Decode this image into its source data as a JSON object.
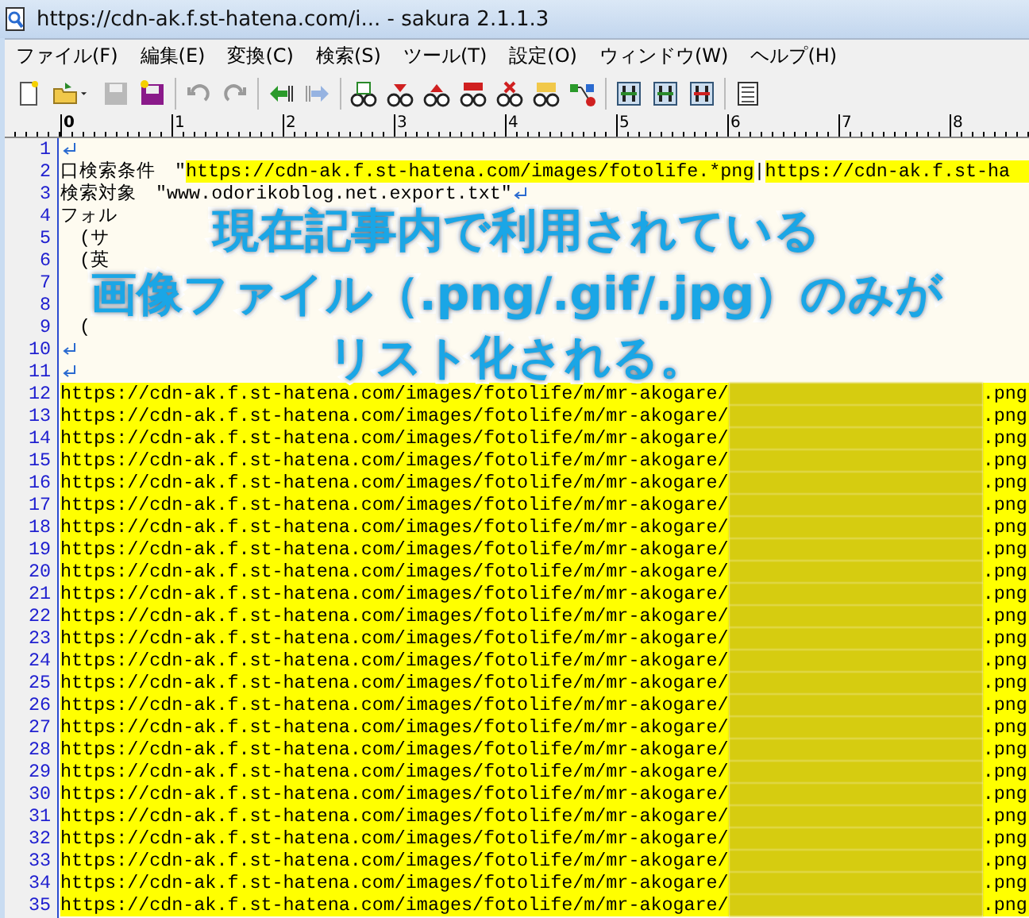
{
  "window": {
    "title": "https://cdn-ak.f.st-hatena.com/i... - sakura 2.1.1.3"
  },
  "menu": [
    "ファイル(F)",
    "編集(E)",
    "変換(C)",
    "検索(S)",
    "ツール(T)",
    "設定(O)",
    "ウィンドウ(W)",
    "ヘルプ(H)"
  ],
  "ruler": [
    "0",
    "1",
    "2",
    "3",
    "4",
    "5",
    "6",
    "7",
    "8"
  ],
  "lines": [
    {
      "number": "1",
      "return_mark": true
    },
    {
      "number": "2",
      "return_mark": false,
      "segments": [
        {
          "kind": "plain",
          "text": "口検索条件　\""
        },
        {
          "kind": "highlight",
          "text": "https://cdn-ak.f.st-hatena.com/images/fotolife.*png"
        },
        {
          "kind": "plain",
          "text": "|"
        },
        {
          "kind": "highlight",
          "text": "https://cdn-ak.f.st-ha"
        }
      ]
    },
    {
      "number": "3",
      "return_mark": true,
      "segments": [
        {
          "kind": "plain",
          "text": "検索対象　\"www.odorikoblog.net.export.txt\""
        }
      ]
    },
    {
      "number": "4",
      "return_mark": false,
      "segments": [
        {
          "kind": "plain",
          "text": "フォル"
        }
      ]
    },
    {
      "number": "5",
      "return_mark": false,
      "segments": [
        {
          "kind": "plain",
          "text": "　(サ"
        }
      ]
    },
    {
      "number": "6",
      "return_mark": false,
      "segments": [
        {
          "kind": "plain",
          "text": "　(英"
        }
      ]
    },
    {
      "number": "7",
      "return_mark": false
    },
    {
      "number": "8",
      "return_mark": false
    },
    {
      "number": "9",
      "return_mark": false,
      "segments": [
        {
          "kind": "plain",
          "text": "　("
        }
      ]
    },
    {
      "number": "10",
      "return_mark": true
    },
    {
      "number": "11",
      "return_mark": true
    },
    {
      "number": "12",
      "return_mark": false,
      "segments": [
        {
          "kind": "highlight",
          "text": "https://cdn-ak.f.st-hatena.com/images/fotolife/m/mr-akogare/"
        },
        {
          "kind": "redacted"
        },
        {
          "kind": "highlight",
          "text": ".png"
        }
      ]
    },
    {
      "number": "13",
      "return_mark": false,
      "segments": [
        {
          "kind": "highlight",
          "text": "https://cdn-ak.f.st-hatena.com/images/fotolife/m/mr-akogare/"
        },
        {
          "kind": "redacted"
        },
        {
          "kind": "highlight",
          "text": ".png"
        }
      ]
    },
    {
      "number": "14",
      "return_mark": false,
      "segments": [
        {
          "kind": "highlight",
          "text": "https://cdn-ak.f.st-hatena.com/images/fotolife/m/mr-akogare/"
        },
        {
          "kind": "redacted"
        },
        {
          "kind": "highlight",
          "text": ".png"
        }
      ]
    },
    {
      "number": "15",
      "return_mark": false,
      "segments": [
        {
          "kind": "highlight",
          "text": "https://cdn-ak.f.st-hatena.com/images/fotolife/m/mr-akogare/"
        },
        {
          "kind": "redacted"
        },
        {
          "kind": "highlight",
          "text": ".png"
        }
      ]
    },
    {
      "number": "16",
      "return_mark": false,
      "segments": [
        {
          "kind": "highlight",
          "text": "https://cdn-ak.f.st-hatena.com/images/fotolife/m/mr-akogare/"
        },
        {
          "kind": "redacted"
        },
        {
          "kind": "highlight",
          "text": ".png"
        }
      ]
    },
    {
      "number": "17",
      "return_mark": false,
      "segments": [
        {
          "kind": "highlight",
          "text": "https://cdn-ak.f.st-hatena.com/images/fotolife/m/mr-akogare/"
        },
        {
          "kind": "redacted"
        },
        {
          "kind": "highlight",
          "text": ".png"
        }
      ]
    },
    {
      "number": "18",
      "return_mark": false,
      "segments": [
        {
          "kind": "highlight",
          "text": "https://cdn-ak.f.st-hatena.com/images/fotolife/m/mr-akogare/"
        },
        {
          "kind": "redacted"
        },
        {
          "kind": "highlight",
          "text": ".png"
        }
      ]
    },
    {
      "number": "19",
      "return_mark": false,
      "segments": [
        {
          "kind": "highlight",
          "text": "https://cdn-ak.f.st-hatena.com/images/fotolife/m/mr-akogare/"
        },
        {
          "kind": "redacted"
        },
        {
          "kind": "highlight",
          "text": ".png"
        }
      ]
    },
    {
      "number": "20",
      "return_mark": false,
      "segments": [
        {
          "kind": "highlight",
          "text": "https://cdn-ak.f.st-hatena.com/images/fotolife/m/mr-akogare/"
        },
        {
          "kind": "redacted"
        },
        {
          "kind": "highlight",
          "text": ".png"
        }
      ]
    },
    {
      "number": "21",
      "return_mark": false,
      "segments": [
        {
          "kind": "highlight",
          "text": "https://cdn-ak.f.st-hatena.com/images/fotolife/m/mr-akogare/"
        },
        {
          "kind": "redacted"
        },
        {
          "kind": "highlight",
          "text": ".png"
        }
      ]
    },
    {
      "number": "22",
      "return_mark": false,
      "segments": [
        {
          "kind": "highlight",
          "text": "https://cdn-ak.f.st-hatena.com/images/fotolife/m/mr-akogare/"
        },
        {
          "kind": "redacted"
        },
        {
          "kind": "highlight",
          "text": ".png"
        }
      ]
    },
    {
      "number": "23",
      "return_mark": false,
      "segments": [
        {
          "kind": "highlight",
          "text": "https://cdn-ak.f.st-hatena.com/images/fotolife/m/mr-akogare/"
        },
        {
          "kind": "redacted"
        },
        {
          "kind": "highlight",
          "text": ".png"
        }
      ]
    },
    {
      "number": "24",
      "return_mark": false,
      "segments": [
        {
          "kind": "highlight",
          "text": "https://cdn-ak.f.st-hatena.com/images/fotolife/m/mr-akogare/"
        },
        {
          "kind": "redacted"
        },
        {
          "kind": "highlight",
          "text": ".png"
        }
      ]
    },
    {
      "number": "25",
      "return_mark": false,
      "segments": [
        {
          "kind": "highlight",
          "text": "https://cdn-ak.f.st-hatena.com/images/fotolife/m/mr-akogare/"
        },
        {
          "kind": "redacted"
        },
        {
          "kind": "highlight",
          "text": ".png"
        }
      ]
    },
    {
      "number": "26",
      "return_mark": false,
      "segments": [
        {
          "kind": "highlight",
          "text": "https://cdn-ak.f.st-hatena.com/images/fotolife/m/mr-akogare/"
        },
        {
          "kind": "redacted"
        },
        {
          "kind": "highlight",
          "text": ".png"
        }
      ]
    },
    {
      "number": "27",
      "return_mark": false,
      "segments": [
        {
          "kind": "highlight",
          "text": "https://cdn-ak.f.st-hatena.com/images/fotolife/m/mr-akogare/"
        },
        {
          "kind": "redacted"
        },
        {
          "kind": "highlight",
          "text": ".png"
        }
      ]
    },
    {
      "number": "28",
      "return_mark": false,
      "segments": [
        {
          "kind": "highlight",
          "text": "https://cdn-ak.f.st-hatena.com/images/fotolife/m/mr-akogare/"
        },
        {
          "kind": "redacted"
        },
        {
          "kind": "highlight",
          "text": ".png"
        }
      ]
    },
    {
      "number": "29",
      "return_mark": false,
      "segments": [
        {
          "kind": "highlight",
          "text": "https://cdn-ak.f.st-hatena.com/images/fotolife/m/mr-akogare/"
        },
        {
          "kind": "redacted"
        },
        {
          "kind": "highlight",
          "text": ".png"
        }
      ]
    },
    {
      "number": "30",
      "return_mark": false,
      "segments": [
        {
          "kind": "highlight",
          "text": "https://cdn-ak.f.st-hatena.com/images/fotolife/m/mr-akogare/"
        },
        {
          "kind": "redacted"
        },
        {
          "kind": "highlight",
          "text": ".png"
        }
      ]
    },
    {
      "number": "31",
      "return_mark": false,
      "segments": [
        {
          "kind": "highlight",
          "text": "https://cdn-ak.f.st-hatena.com/images/fotolife/m/mr-akogare/"
        },
        {
          "kind": "redacted"
        },
        {
          "kind": "highlight",
          "text": ".png"
        }
      ]
    },
    {
      "number": "32",
      "return_mark": false,
      "segments": [
        {
          "kind": "highlight",
          "text": "https://cdn-ak.f.st-hatena.com/images/fotolife/m/mr-akogare/"
        },
        {
          "kind": "redacted"
        },
        {
          "kind": "highlight",
          "text": ".png"
        }
      ]
    },
    {
      "number": "33",
      "return_mark": false,
      "segments": [
        {
          "kind": "highlight",
          "text": "https://cdn-ak.f.st-hatena.com/images/fotolife/m/mr-akogare/"
        },
        {
          "kind": "redacted"
        },
        {
          "kind": "highlight",
          "text": ".png"
        }
      ]
    },
    {
      "number": "34",
      "return_mark": false,
      "segments": [
        {
          "kind": "highlight",
          "text": "https://cdn-ak.f.st-hatena.com/images/fotolife/m/mr-akogare/"
        },
        {
          "kind": "redacted"
        },
        {
          "kind": "highlight",
          "text": ".png"
        }
      ]
    },
    {
      "number": "35",
      "return_mark": false,
      "segments": [
        {
          "kind": "highlight",
          "text": "https://cdn-ak.f.st-hatena.com/images/fotolife/m/mr-akogare/"
        },
        {
          "kind": "redacted"
        },
        {
          "kind": "highlight",
          "text": ".png"
        }
      ]
    }
  ],
  "caption": [
    "現在記事内で利用されている",
    "画像ファイル（.png/.gif/.jpg）のみが",
    "リスト化される。"
  ]
}
